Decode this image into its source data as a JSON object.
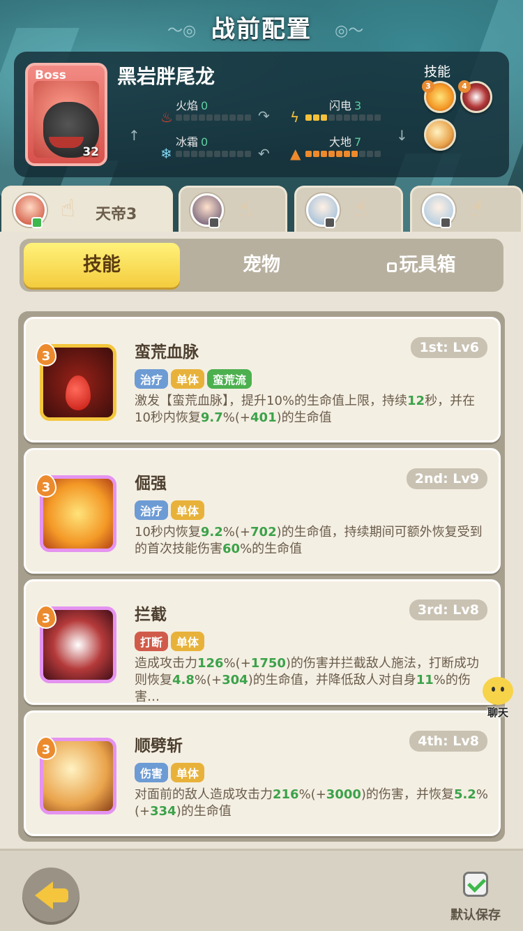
{
  "header": {
    "title": "战前配置"
  },
  "boss": {
    "tag": "Boss",
    "name": "黑岩胖尾龙",
    "level": "32",
    "skills_label": "技能",
    "skill_orbs": [
      {
        "num": "3"
      },
      {
        "num": "4"
      },
      {
        "num": ""
      }
    ],
    "stats": [
      {
        "label": "火焰",
        "value": "0",
        "fill": 0,
        "icon": "fire-icon"
      },
      {
        "label": "闪电",
        "value": "3",
        "fill": 3,
        "icon": "lightning-icon"
      },
      {
        "label": "冰霜",
        "value": "0",
        "fill": 0,
        "icon": "frost-icon"
      },
      {
        "label": "大地",
        "value": "7",
        "fill": 7,
        "icon": "earth-icon"
      }
    ]
  },
  "characters": [
    {
      "name": "天帝3",
      "active": true
    },
    {
      "name": "",
      "active": false
    },
    {
      "name": "",
      "active": false
    },
    {
      "name": "",
      "active": false
    }
  ],
  "tabs": [
    {
      "label": "技能",
      "active": true
    },
    {
      "label": "宠物",
      "active": false
    },
    {
      "label": "玩具箱",
      "active": false,
      "locked": true
    }
  ],
  "skills": [
    {
      "name": "蛮荒血脉",
      "slot": "1st: Lv6",
      "rank": "3",
      "tags": [
        {
          "t": "治疗",
          "c": "blue"
        },
        {
          "t": "单体",
          "c": "yellow"
        },
        {
          "t": "蛮荒流",
          "c": "green"
        }
      ],
      "desc_parts": [
        "激发【蛮荒血脉】，提升10%的生命值上限，持续",
        "12",
        "秒，并在10秒内恢复",
        "9.7",
        "%(+",
        "401",
        ")的生命值"
      ]
    },
    {
      "name": "倔强",
      "slot": "2nd: Lv9",
      "rank": "3",
      "tags": [
        {
          "t": "治疗",
          "c": "blue"
        },
        {
          "t": "单体",
          "c": "yellow"
        }
      ],
      "desc_parts": [
        "10秒内恢复",
        "9.2",
        "%(+",
        "702",
        ")的生命值，持续期间可额外恢复受到的首次技能伤害",
        "60",
        "%的生命值"
      ]
    },
    {
      "name": "拦截",
      "slot": "3rd: Lv8",
      "rank": "3",
      "tags": [
        {
          "t": "打断",
          "c": "red"
        },
        {
          "t": "单体",
          "c": "yellow"
        }
      ],
      "desc_parts": [
        "造成攻击力",
        "126",
        "%(+",
        "1750",
        ")的伤害并拦截敌人施法，打断成功则恢复",
        "4.8",
        "%(+",
        "304",
        ")的生命值，并降低敌人对自身",
        "11",
        "%的伤害…"
      ]
    },
    {
      "name": "顺劈斩",
      "slot": "4th: Lv8",
      "rank": "3",
      "tags": [
        {
          "t": "伤害",
          "c": "blue"
        },
        {
          "t": "单体",
          "c": "yellow"
        }
      ],
      "desc_parts": [
        "对面前的敌人造成攻击力",
        "216",
        "%(+",
        "3000",
        ")的伤害，并恢复",
        "5.2",
        "%(+",
        "334",
        ")的生命值"
      ]
    }
  ],
  "chat": {
    "label": "聊天"
  },
  "footer": {
    "save_label": "默认保存"
  }
}
